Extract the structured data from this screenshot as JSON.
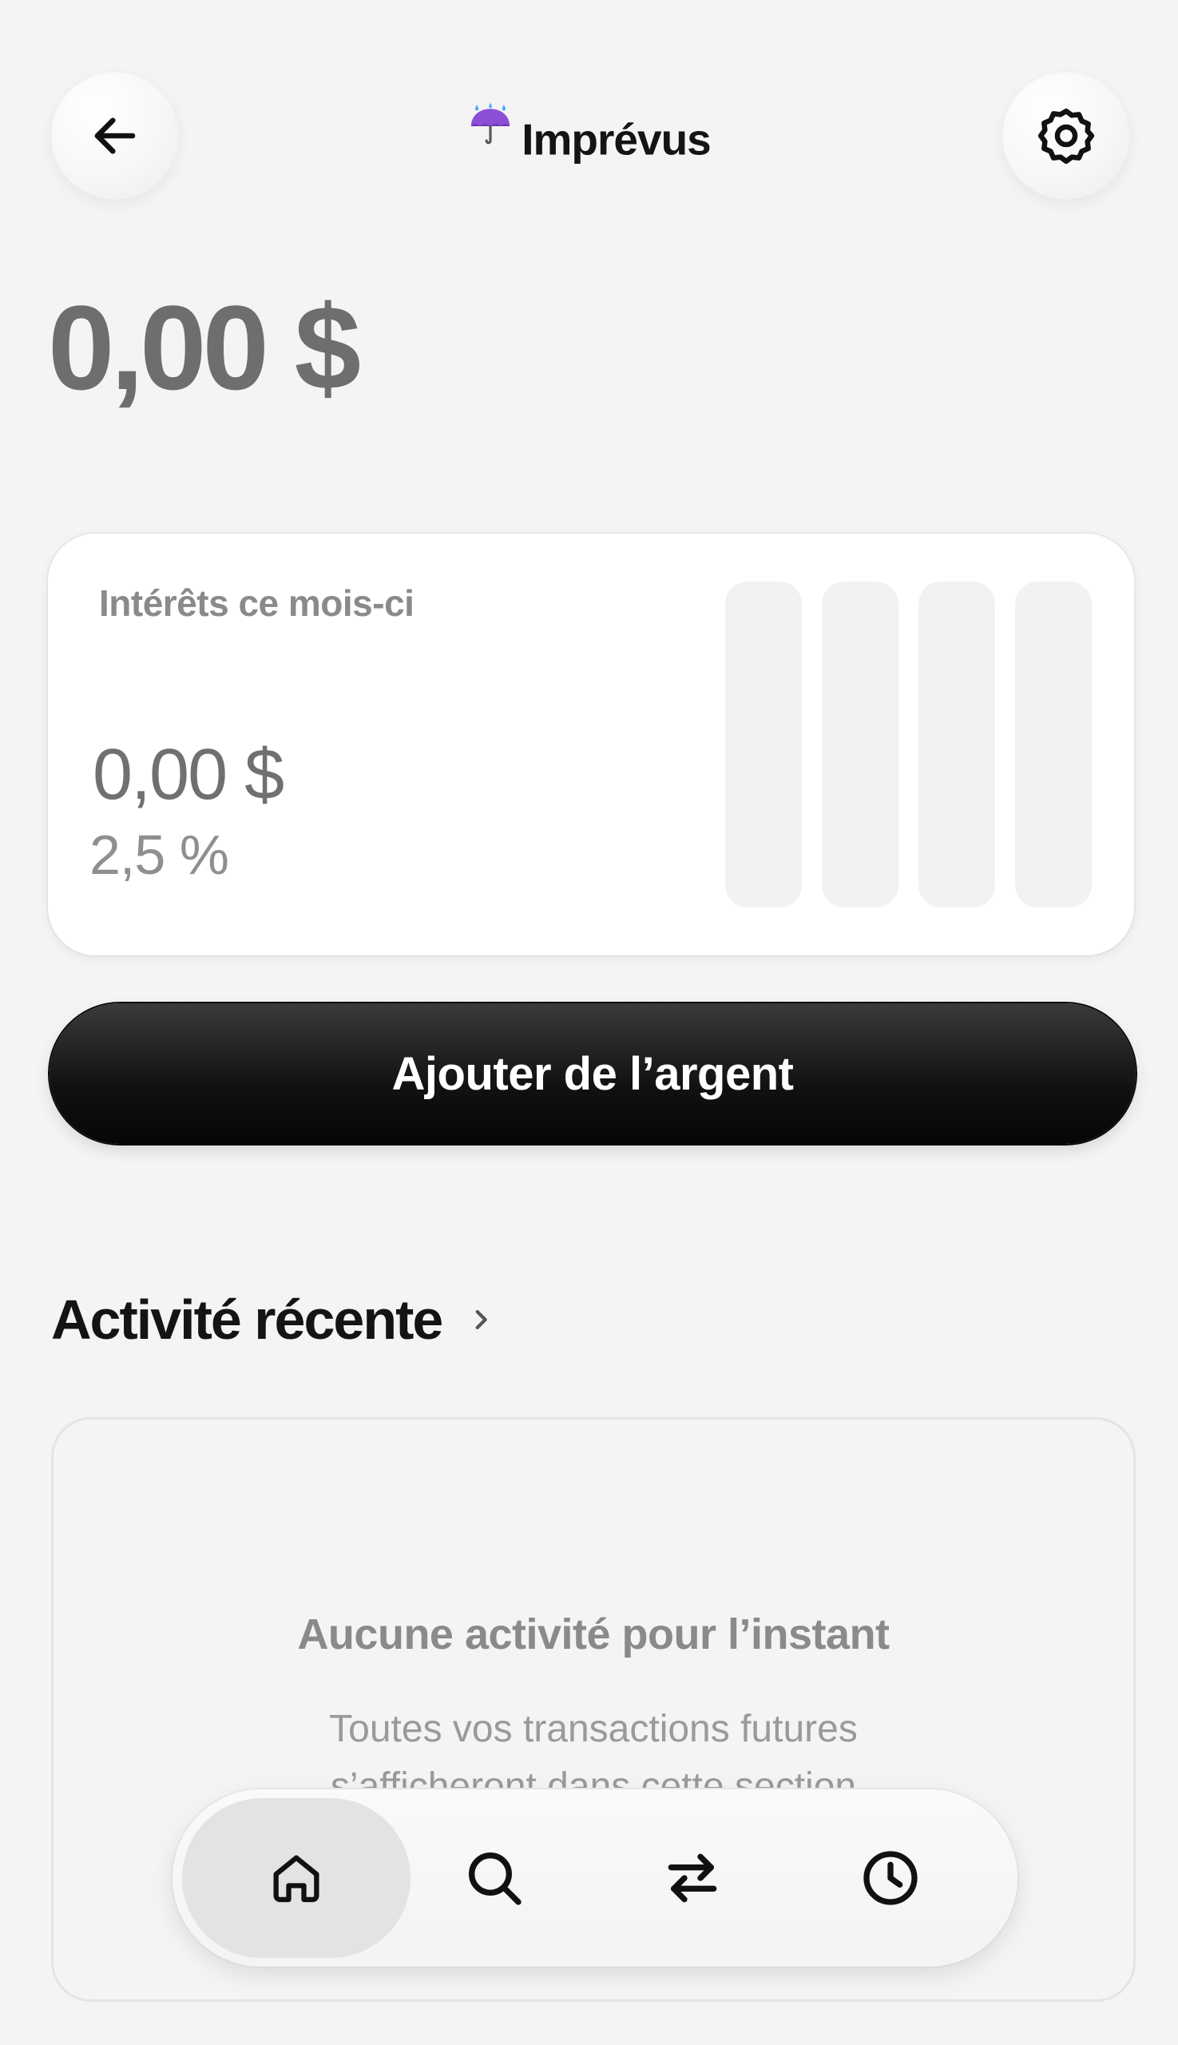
{
  "header": {
    "emoji": "☔",
    "title": "Imprévus",
    "back_icon": "arrow-left-icon",
    "settings_icon": "gear-icon"
  },
  "balance": {
    "amount": "0,00 $"
  },
  "interest_card": {
    "label": "Intérêts ce mois-ci",
    "amount": "0,00 $",
    "rate": "2,5 %"
  },
  "actions": {
    "add_money_label": "Ajouter de l’argent"
  },
  "recent_activity": {
    "title": "Activité récente",
    "empty_title": "Aucune activité pour l’instant",
    "empty_desc_line1": "Toutes vos transactions futures",
    "empty_desc_line2": "s’afficheront dans cette section"
  },
  "bottom_nav": {
    "items": [
      {
        "icon": "home-icon",
        "active": true
      },
      {
        "icon": "search-icon",
        "active": false
      },
      {
        "icon": "transfer-icon",
        "active": false
      },
      {
        "icon": "clock-icon",
        "active": false
      }
    ]
  },
  "colors": {
    "background": "#f4f4f4",
    "text_primary": "#141414",
    "text_muted": "#8a8a8a",
    "button_dark": "#111111",
    "umbrella": "#8b4fd6"
  }
}
